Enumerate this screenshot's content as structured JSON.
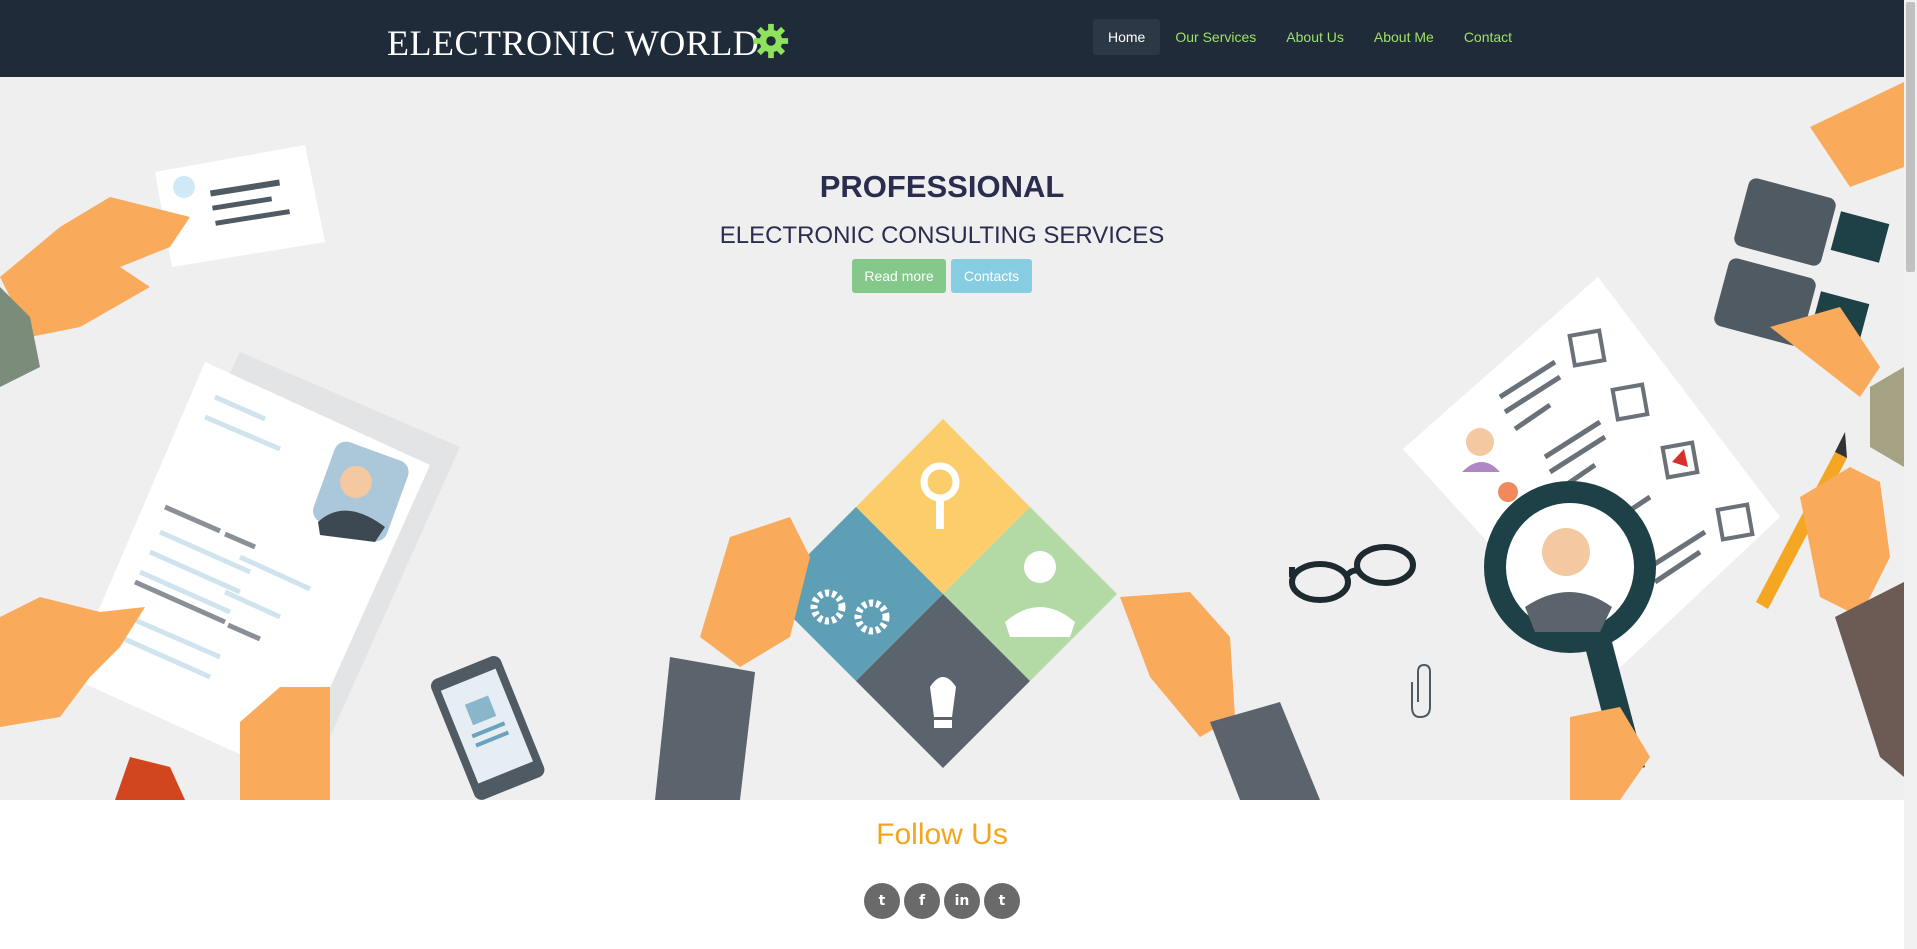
{
  "brand": {
    "name": "ELECTRONIC WORLD",
    "icon": "gear-icon",
    "icon_color": "#8fe25c"
  },
  "nav": {
    "items": [
      {
        "label": "Home",
        "active": true
      },
      {
        "label": "Our Services",
        "active": false
      },
      {
        "label": "About Us",
        "active": false
      },
      {
        "label": "About Me",
        "active": false
      },
      {
        "label": "Contact",
        "active": false
      }
    ]
  },
  "hero": {
    "title": "PROFESSIONAL",
    "subtitle": "ELECTRONIC CONSULTING SERVICES",
    "read_more_label": "Read more",
    "contacts_label": "Contacts"
  },
  "follow": {
    "title": "Follow Us",
    "icons": [
      {
        "name": "twitter-icon",
        "glyph": "t"
      },
      {
        "name": "facebook-icon",
        "glyph": "f"
      },
      {
        "name": "linkedin-icon",
        "glyph": "in"
      },
      {
        "name": "twitter-icon",
        "glyph": "t"
      }
    ]
  },
  "colors": {
    "navbar": "#1f2b38",
    "nav_link": "#9de26a",
    "hero_bg": "#efefef",
    "title": "#2b2d4e",
    "accent": "#f3a61d",
    "btn_green": "#84c88a",
    "btn_blue": "#87cde2"
  }
}
